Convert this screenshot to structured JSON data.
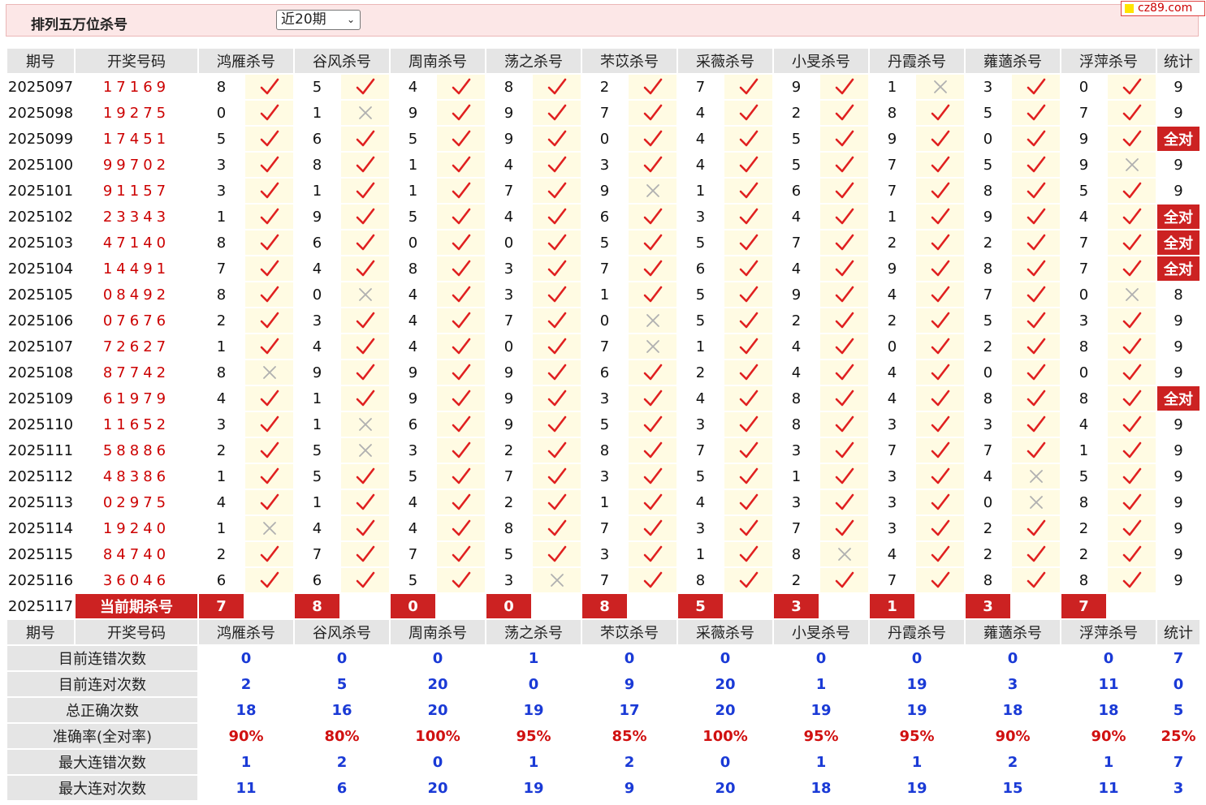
{
  "header": {
    "title": "排列五万位杀号",
    "select_value": "近20期",
    "brand": "cz89.com"
  },
  "columns": {
    "period": "期号",
    "winning": "开奖号码",
    "total": "统计",
    "experts": [
      "鸿雁杀号",
      "谷风杀号",
      "周南杀号",
      "荡之杀号",
      "芣苡杀号",
      "采薇杀号",
      "小旻杀号",
      "丹霞杀号",
      "蕹藡杀号",
      "浮萍杀号"
    ]
  },
  "all_right_label": "全对",
  "rows": [
    {
      "period": "2025097",
      "num": "17169",
      "kills": [
        8,
        5,
        4,
        8,
        2,
        7,
        9,
        1,
        3,
        0
      ],
      "marks": [
        1,
        1,
        1,
        1,
        1,
        1,
        1,
        0,
        1,
        1
      ],
      "total": "9"
    },
    {
      "period": "2025098",
      "num": "19275",
      "kills": [
        0,
        1,
        9,
        9,
        7,
        4,
        2,
        8,
        5,
        7
      ],
      "marks": [
        1,
        0,
        1,
        1,
        1,
        1,
        1,
        1,
        1,
        1
      ],
      "total": "9"
    },
    {
      "period": "2025099",
      "num": "17451",
      "kills": [
        5,
        6,
        5,
        9,
        0,
        4,
        5,
        9,
        0,
        9
      ],
      "marks": [
        1,
        1,
        1,
        1,
        1,
        1,
        1,
        1,
        1,
        1
      ],
      "total": "全对"
    },
    {
      "period": "2025100",
      "num": "99702",
      "kills": [
        3,
        8,
        1,
        4,
        3,
        4,
        5,
        7,
        5,
        9
      ],
      "marks": [
        1,
        1,
        1,
        1,
        1,
        1,
        1,
        1,
        1,
        0
      ],
      "total": "9"
    },
    {
      "period": "2025101",
      "num": "91157",
      "kills": [
        3,
        1,
        1,
        7,
        9,
        1,
        6,
        7,
        8,
        5
      ],
      "marks": [
        1,
        1,
        1,
        1,
        0,
        1,
        1,
        1,
        1,
        1
      ],
      "total": "9"
    },
    {
      "period": "2025102",
      "num": "23343",
      "kills": [
        1,
        9,
        5,
        4,
        6,
        3,
        4,
        1,
        9,
        4
      ],
      "marks": [
        1,
        1,
        1,
        1,
        1,
        1,
        1,
        1,
        1,
        1
      ],
      "total": "全对"
    },
    {
      "period": "2025103",
      "num": "47140",
      "kills": [
        8,
        6,
        0,
        0,
        5,
        5,
        7,
        2,
        2,
        7
      ],
      "marks": [
        1,
        1,
        1,
        1,
        1,
        1,
        1,
        1,
        1,
        1
      ],
      "total": "全对"
    },
    {
      "period": "2025104",
      "num": "14491",
      "kills": [
        7,
        4,
        8,
        3,
        7,
        6,
        4,
        9,
        8,
        7
      ],
      "marks": [
        1,
        1,
        1,
        1,
        1,
        1,
        1,
        1,
        1,
        1
      ],
      "total": "全对"
    },
    {
      "period": "2025105",
      "num": "08492",
      "kills": [
        8,
        0,
        4,
        3,
        1,
        5,
        9,
        4,
        7,
        0
      ],
      "marks": [
        1,
        0,
        1,
        1,
        1,
        1,
        1,
        1,
        1,
        0
      ],
      "total": "8"
    },
    {
      "period": "2025106",
      "num": "07676",
      "kills": [
        2,
        3,
        4,
        7,
        0,
        5,
        2,
        2,
        5,
        3
      ],
      "marks": [
        1,
        1,
        1,
        1,
        0,
        1,
        1,
        1,
        1,
        1
      ],
      "total": "9"
    },
    {
      "period": "2025107",
      "num": "72627",
      "kills": [
        1,
        4,
        4,
        0,
        7,
        1,
        4,
        0,
        2,
        8
      ],
      "marks": [
        1,
        1,
        1,
        1,
        0,
        1,
        1,
        1,
        1,
        1
      ],
      "total": "9"
    },
    {
      "period": "2025108",
      "num": "87742",
      "kills": [
        8,
        9,
        9,
        9,
        6,
        2,
        4,
        4,
        0,
        0
      ],
      "marks": [
        0,
        1,
        1,
        1,
        1,
        1,
        1,
        1,
        1,
        1
      ],
      "total": "9"
    },
    {
      "period": "2025109",
      "num": "61979",
      "kills": [
        4,
        1,
        9,
        9,
        3,
        4,
        8,
        4,
        8,
        8
      ],
      "marks": [
        1,
        1,
        1,
        1,
        1,
        1,
        1,
        1,
        1,
        1
      ],
      "total": "全对"
    },
    {
      "period": "2025110",
      "num": "11652",
      "kills": [
        3,
        1,
        6,
        9,
        5,
        3,
        8,
        3,
        3,
        4
      ],
      "marks": [
        1,
        0,
        1,
        1,
        1,
        1,
        1,
        1,
        1,
        1
      ],
      "total": "9"
    },
    {
      "period": "2025111",
      "num": "58886",
      "kills": [
        2,
        5,
        3,
        2,
        8,
        7,
        3,
        7,
        7,
        1
      ],
      "marks": [
        1,
        0,
        1,
        1,
        1,
        1,
        1,
        1,
        1,
        1
      ],
      "total": "9"
    },
    {
      "period": "2025112",
      "num": "48386",
      "kills": [
        1,
        5,
        5,
        7,
        3,
        5,
        1,
        3,
        4,
        5
      ],
      "marks": [
        1,
        1,
        1,
        1,
        1,
        1,
        1,
        1,
        0,
        1
      ],
      "total": "9"
    },
    {
      "period": "2025113",
      "num": "02975",
      "kills": [
        4,
        1,
        4,
        2,
        1,
        4,
        3,
        3,
        0,
        8
      ],
      "marks": [
        1,
        1,
        1,
        1,
        1,
        1,
        1,
        1,
        0,
        1
      ],
      "total": "9"
    },
    {
      "period": "2025114",
      "num": "19240",
      "kills": [
        1,
        4,
        4,
        8,
        7,
        3,
        7,
        3,
        2,
        2
      ],
      "marks": [
        0,
        1,
        1,
        1,
        1,
        1,
        1,
        1,
        1,
        1
      ],
      "total": "9"
    },
    {
      "period": "2025115",
      "num": "84740",
      "kills": [
        2,
        7,
        7,
        5,
        3,
        1,
        8,
        4,
        2,
        2
      ],
      "marks": [
        1,
        1,
        1,
        1,
        1,
        1,
        0,
        1,
        1,
        1
      ],
      "total": "9"
    },
    {
      "period": "2025116",
      "num": "36046",
      "kills": [
        6,
        6,
        5,
        3,
        7,
        8,
        2,
        7,
        8,
        8
      ],
      "marks": [
        1,
        1,
        1,
        0,
        1,
        1,
        1,
        1,
        1,
        1
      ],
      "total": "9"
    }
  ],
  "current": {
    "period": "2025117",
    "label": "当前期杀号",
    "kills": [
      7,
      8,
      0,
      0,
      8,
      5,
      3,
      1,
      3,
      7
    ]
  },
  "stats": [
    {
      "label": "目前连错次数",
      "values": [
        "0",
        "0",
        "0",
        "1",
        "0",
        "0",
        "0",
        "0",
        "0",
        "0"
      ],
      "total": "7",
      "red": false
    },
    {
      "label": "目前连对次数",
      "values": [
        "2",
        "5",
        "20",
        "0",
        "9",
        "20",
        "1",
        "19",
        "3",
        "11"
      ],
      "total": "0",
      "red": false
    },
    {
      "label": "总正确次数",
      "values": [
        "18",
        "16",
        "20",
        "19",
        "17",
        "20",
        "19",
        "19",
        "18",
        "18"
      ],
      "total": "5",
      "red": false
    },
    {
      "label": "准确率(全对率)",
      "values": [
        "90%",
        "80%",
        "100%",
        "95%",
        "85%",
        "100%",
        "95%",
        "95%",
        "90%",
        "90%"
      ],
      "total": "25%",
      "red": true
    },
    {
      "label": "最大连错次数",
      "values": [
        "1",
        "2",
        "0",
        "1",
        "2",
        "0",
        "1",
        "1",
        "2",
        "1"
      ],
      "total": "7",
      "red": false
    },
    {
      "label": "最大连对次数",
      "values": [
        "11",
        "6",
        "20",
        "19",
        "9",
        "20",
        "18",
        "19",
        "15",
        "11"
      ],
      "total": "3",
      "red": false
    }
  ],
  "colors": {
    "accent_red": "#cc2222",
    "check": "#e02020",
    "cross": "#b0b0b0",
    "stat_blue": "#1a3ad6",
    "mark_bg": "#fffbe3"
  }
}
